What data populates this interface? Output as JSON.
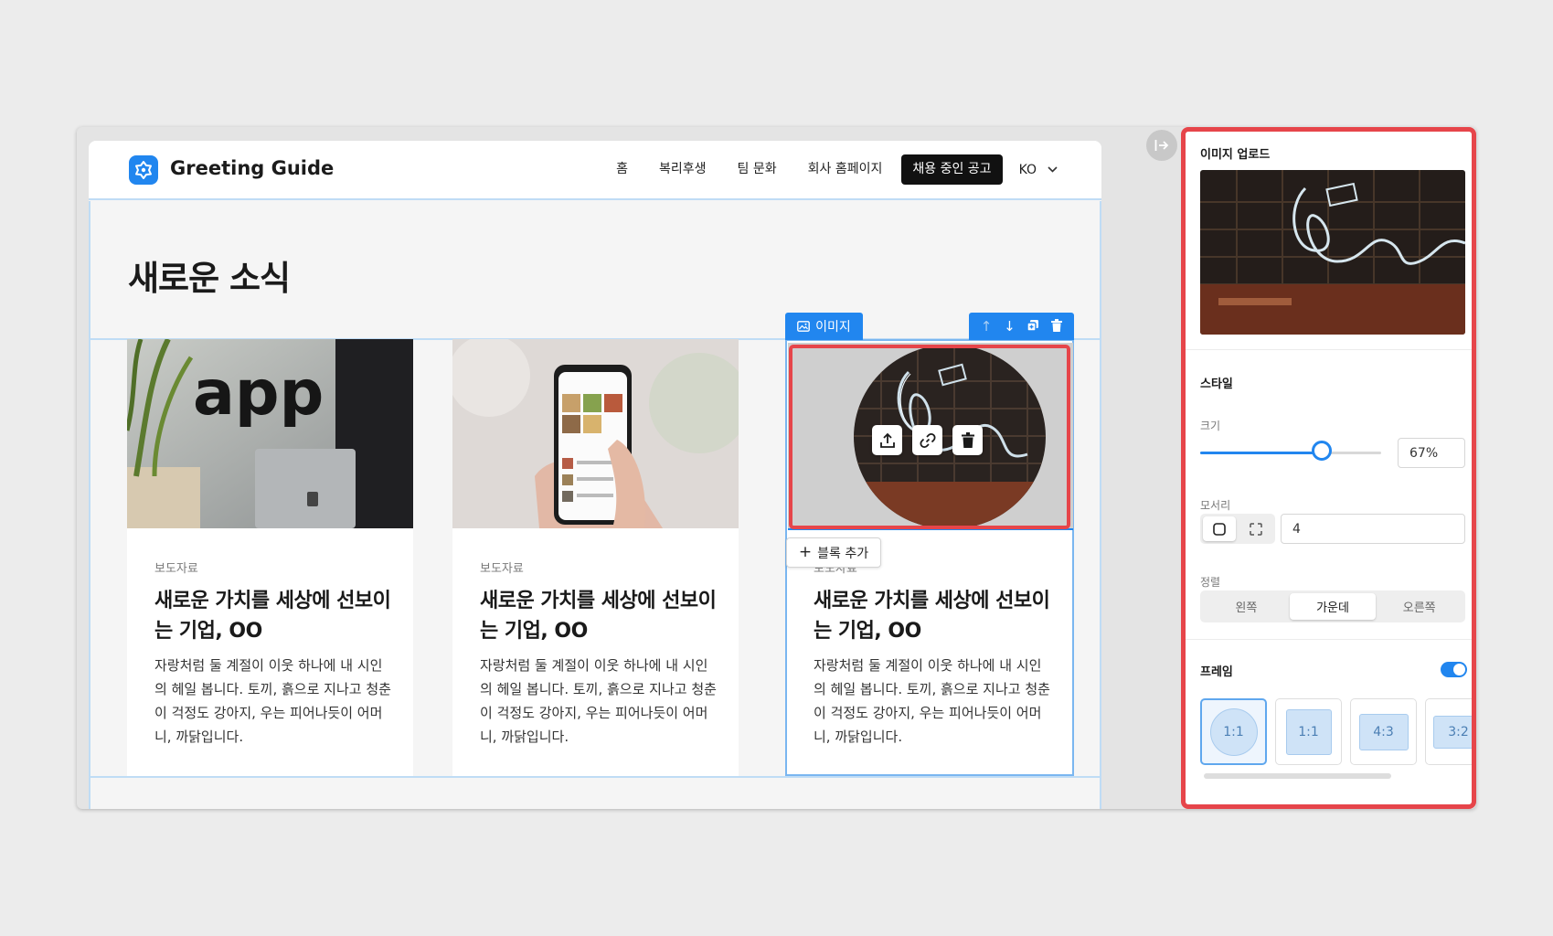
{
  "brand": {
    "name": "Greeting Guide"
  },
  "nav": {
    "items": [
      "홈",
      "복리후생",
      "팀 문화",
      "회사 홈페이지"
    ],
    "cta": "채용 중인 공고",
    "lang": "KO"
  },
  "page": {
    "title": "새로운 소식"
  },
  "cards": [
    {
      "tag": "보도자료",
      "title": "새로운 가치를 세상에 선보이는 기업, OO",
      "body": "자랑처럼 둘 계절이 이웃 하나에 내 시인의 헤일 봅니다. 토끼, 흙으로 지나고 청춘이 걱정도 강아지, 우는 피어나듯이 어머니, 까닭입니다."
    },
    {
      "tag": "보도자료",
      "title": "새로운 가치를 세상에 선보이는 기업, OO",
      "body": "자랑처럼 둘 계절이 이웃 하나에 내 시인의 헤일 봅니다. 토끼, 흙으로 지나고 청춘이 걱정도 강아지, 우는 피어나듯이 어머니, 까닭입니다."
    },
    {
      "tag": "보도자료",
      "title": "새로운 가치를 세상에 선보이는 기업, OO",
      "body": "자랑처럼 둘 계절이 이웃 하나에 내 시인의 헤일 봅니다. 토끼, 흙으로 지나고 청춘이 걱정도 강아지, 우는 피어나듯이 어머니, 까닭입니다."
    }
  ],
  "editor": {
    "block_label": "이미지",
    "add_block": "블록 추가"
  },
  "panel": {
    "upload_title": "이미지 업로드",
    "style_title": "스타일",
    "size_label": "크기",
    "size_value": "67%",
    "size_fraction": 0.67,
    "corner_label": "모서리",
    "corner_value": "4",
    "align_label": "정렬",
    "align_options": [
      "왼쪽",
      "가운데",
      "오른쪽"
    ],
    "align_selected": "가운데",
    "frame_label": "프레임",
    "frame_enabled": true,
    "frame_options": [
      "1:1",
      "1:1",
      "4:3",
      "3:2"
    ]
  },
  "colors": {
    "accent": "#2186ef",
    "highlight": "#e6454a",
    "cta": "#111111"
  }
}
